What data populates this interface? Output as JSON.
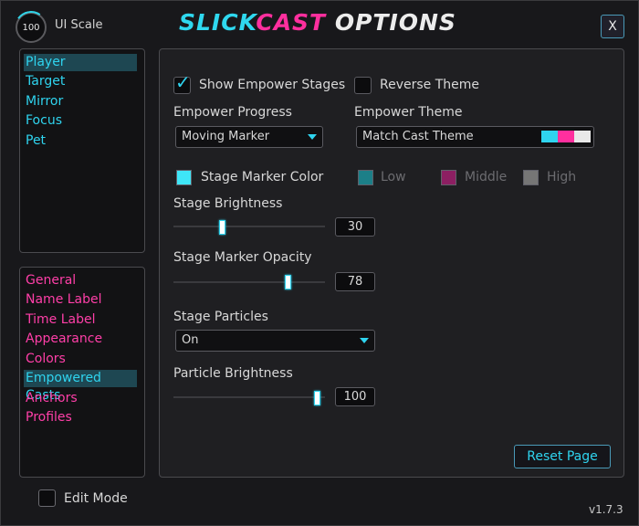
{
  "header": {
    "ui_scale_value": "100",
    "ui_scale_label": "UI Scale",
    "title_part1": "SLICK",
    "title_part2": "CAST",
    "title_part3": " OPTIONS",
    "close_label": "X"
  },
  "unit_nav": [
    "Player",
    "Target",
    "Mirror",
    "Focus",
    "Pet"
  ],
  "page_nav": [
    "General",
    "Name Label",
    "Time Label",
    "Appearance",
    "Colors",
    "Empowered Casts",
    "Anchors",
    "Profiles"
  ],
  "selected": {
    "unit": "Player",
    "page": "Empowered Casts"
  },
  "settings": {
    "show_empower_stages": {
      "label": "Show Empower Stages",
      "checked": true
    },
    "reverse_theme": {
      "label": "Reverse Theme",
      "checked": false
    },
    "empower_progress": {
      "label": "Empower Progress",
      "value": "Moving Marker"
    },
    "empower_theme": {
      "label": "Empower Theme",
      "value": "Match Cast Theme"
    },
    "stage_marker_color": {
      "label": "Stage Marker Color",
      "color": "#3fe6f7"
    },
    "low": {
      "label": "Low",
      "color": "#1c7f88"
    },
    "middle": {
      "label": "Middle",
      "color": "#8c1f62"
    },
    "high": {
      "label": "High",
      "color": "#767676"
    },
    "stage_brightness": {
      "label": "Stage Brightness",
      "value": 30
    },
    "stage_marker_opacity": {
      "label": "Stage Marker Opacity",
      "value": 78
    },
    "stage_particles": {
      "label": "Stage Particles",
      "value": "On"
    },
    "particle_brightness": {
      "label": "Particle Brightness",
      "value": 100
    }
  },
  "theme_colors": [
    "#2fd4ef",
    "#ff2f9e",
    "#e8e8e8"
  ],
  "reset_label": "Reset Page",
  "edit_mode_label": "Edit Mode",
  "version": "v1.7.3"
}
